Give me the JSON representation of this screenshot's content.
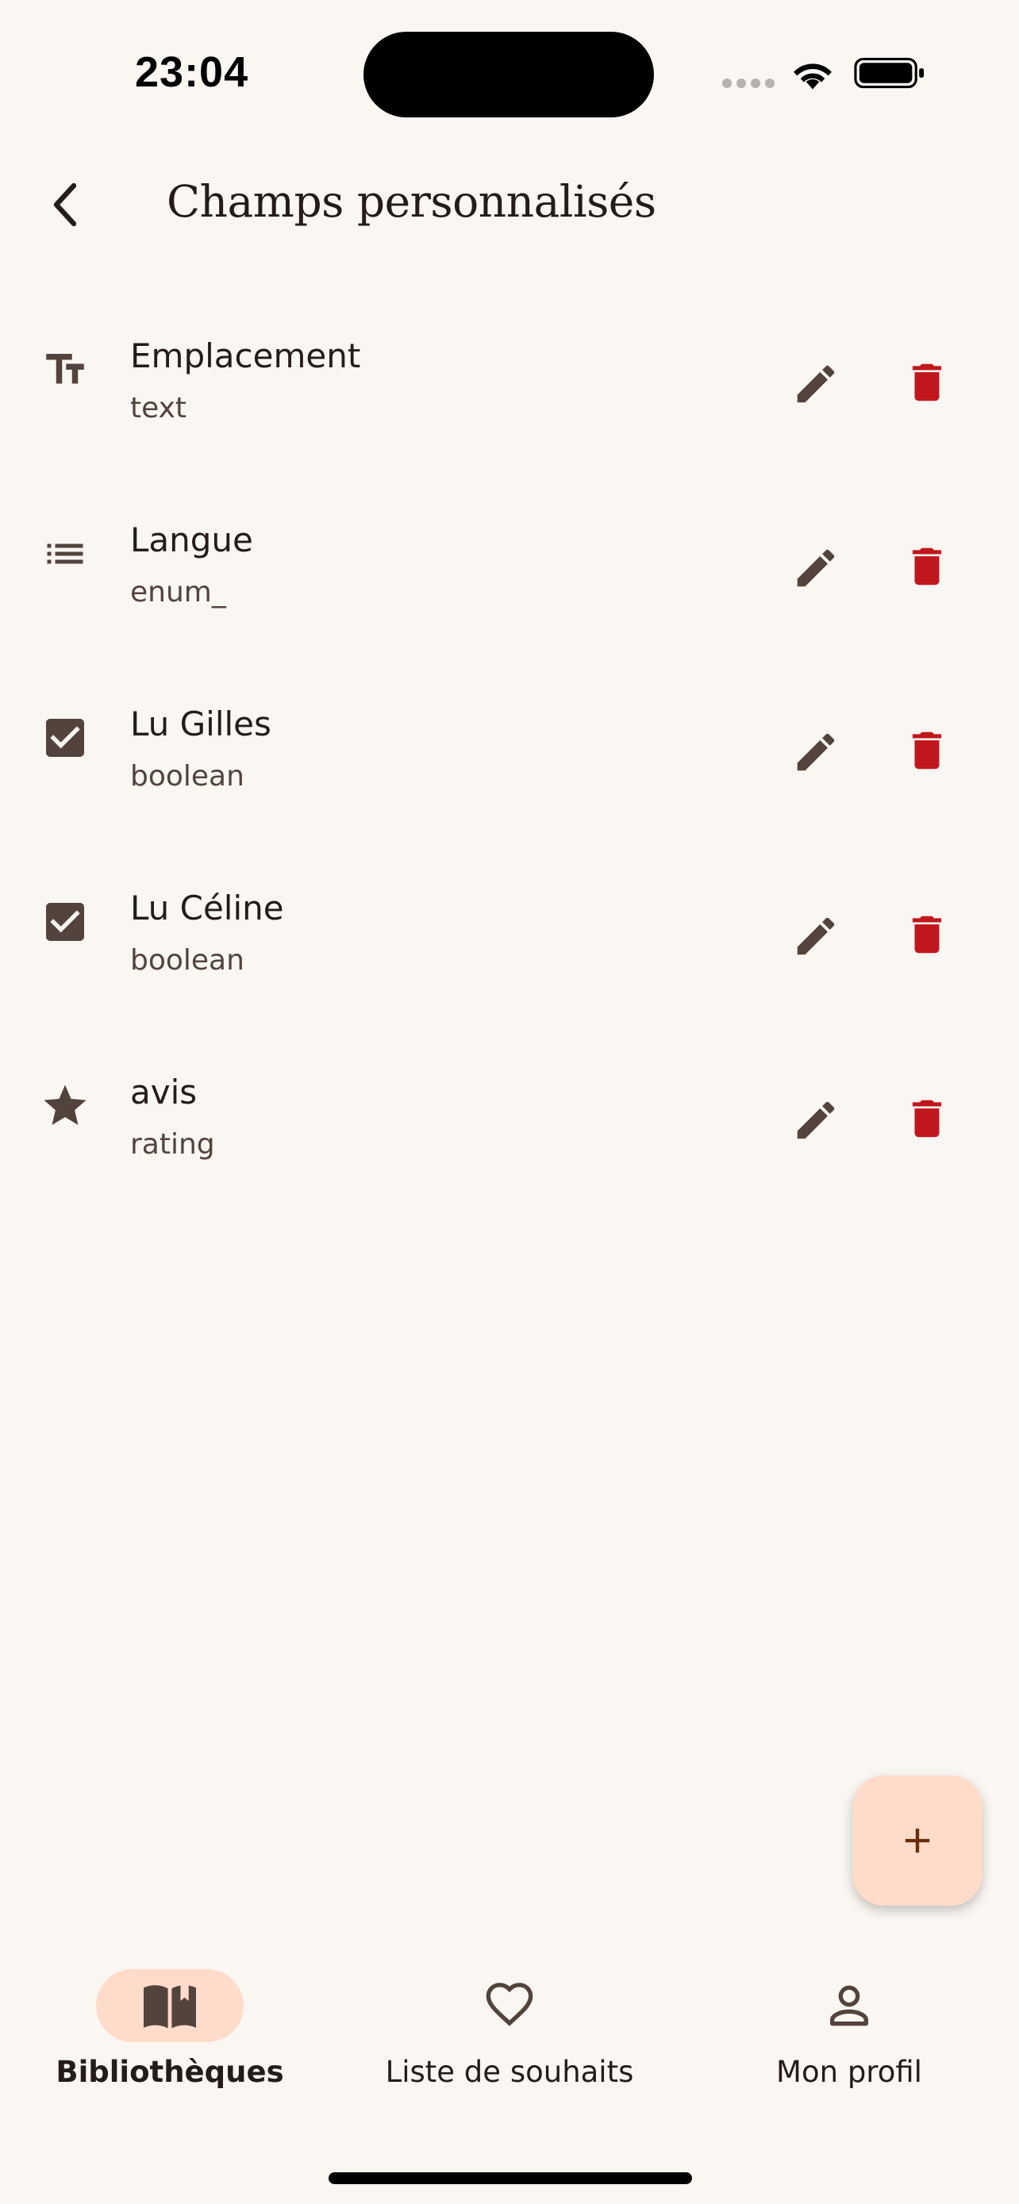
{
  "status_bar": {
    "time": "23:04",
    "icons": [
      "signal-dots-icon",
      "wifi-icon",
      "battery-icon"
    ]
  },
  "header": {
    "back_icon": "chevron-left-icon",
    "title": "Champs personnalisés"
  },
  "fields": [
    {
      "name": "Emplacement",
      "type": "text",
      "icon": "text-fields-icon"
    },
    {
      "name": "Langue",
      "type": "enum_",
      "icon": "list-icon"
    },
    {
      "name": "Lu Gilles",
      "type": "boolean",
      "icon": "checkbox-icon"
    },
    {
      "name": "Lu Céline",
      "type": "boolean",
      "icon": "checkbox-icon"
    },
    {
      "name": "avis",
      "type": "rating",
      "icon": "star-icon"
    }
  ],
  "row_actions": {
    "edit_icon": "pencil-icon",
    "delete_icon": "trash-icon"
  },
  "fab": {
    "icon": "plus-icon"
  },
  "bottom_nav": {
    "items": [
      {
        "label": "Bibliothèques",
        "icon": "book-icon",
        "active": true
      },
      {
        "label": "Liste de souhaits",
        "icon": "heart-icon",
        "active": false
      },
      {
        "label": "Mon profil",
        "icon": "person-icon",
        "active": false
      }
    ]
  },
  "colors": {
    "background": "#faf6f2",
    "icon": "#52443c",
    "delete": "#c0171c",
    "accent_container": "#ffdbca",
    "fab_icon": "#6b2d00"
  }
}
